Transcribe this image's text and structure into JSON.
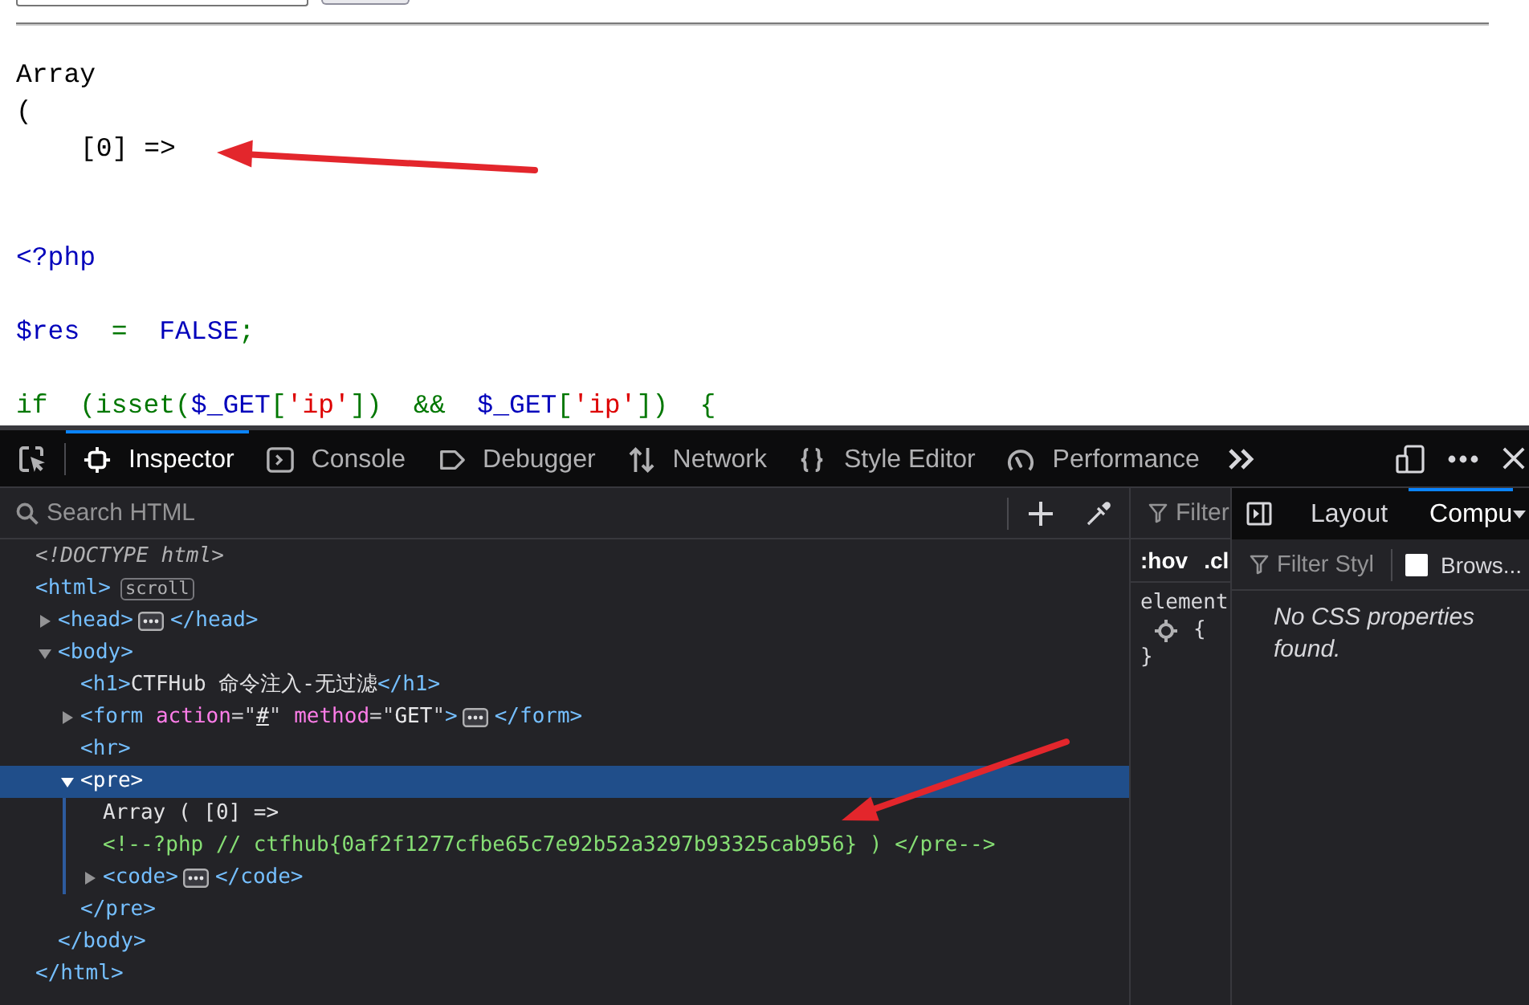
{
  "page": {
    "output": {
      "header": "Array",
      "open_paren": "(",
      "entries": [
        "[0] =>"
      ]
    },
    "code_blocks": [
      {
        "lines": [
          {
            "tokens": [
              {
                "kind": "default",
                "text": "<?php"
              }
            ]
          }
        ]
      },
      {
        "lines": [
          {
            "tokens": [
              {
                "kind": "default",
                "text": "$res"
              },
              {
                "kind": "keyword",
                "text": "  =  "
              },
              {
                "kind": "default",
                "text": "FALSE"
              },
              {
                "kind": "keyword",
                "text": ";"
              }
            ]
          }
        ]
      },
      {
        "lines": [
          {
            "tokens": [
              {
                "kind": "keyword",
                "text": "if  (isset("
              },
              {
                "kind": "default",
                "text": "$_GET"
              },
              {
                "kind": "keyword",
                "text": "["
              },
              {
                "kind": "string",
                "text": "'ip'"
              },
              {
                "kind": "keyword",
                "text": "])  &&  "
              },
              {
                "kind": "default",
                "text": "$_GET"
              },
              {
                "kind": "keyword",
                "text": "["
              },
              {
                "kind": "string",
                "text": "'ip'"
              },
              {
                "kind": "keyword",
                "text": "])  {"
              }
            ]
          }
        ]
      }
    ]
  },
  "devtools": {
    "toolbar": {
      "tabs": [
        {
          "kind": "inspector",
          "label": "Inspector",
          "selected": true
        },
        {
          "kind": "console",
          "label": "Console",
          "selected": false
        },
        {
          "kind": "debugger",
          "label": "Debugger",
          "selected": false
        },
        {
          "kind": "network",
          "label": "Network",
          "selected": false
        },
        {
          "kind": "styles",
          "label": "Style Editor",
          "selected": false
        },
        {
          "kind": "performance",
          "label": "Performance",
          "selected": false
        }
      ]
    },
    "search": {
      "placeholder": "Search HTML"
    },
    "tree": [
      {
        "selected": false,
        "open": [
          {
            "kind": "doctype",
            "text": "<!DOCTYPE html>"
          }
        ]
      },
      {
        "selected": false,
        "open": [
          {
            "kind": "tag",
            "text": "<html>"
          }
        ],
        "badge": "scroll",
        "close": [
          {
            "kind": "tag",
            "text": "</html>"
          }
        ],
        "children": [
          {
            "selected": false,
            "expanded": false,
            "open": [
              {
                "kind": "tag",
                "text": "<head>"
              }
            ],
            "close": [
              {
                "kind": "tag",
                "text": "</head>"
              }
            ]
          },
          {
            "selected": false,
            "expanded": true,
            "open": [
              {
                "kind": "tag",
                "text": "<body>"
              }
            ],
            "close": [
              {
                "kind": "tag",
                "text": "</body>"
              }
            ],
            "children": [
              {
                "selected": false,
                "open": [
                  {
                    "kind": "tag",
                    "text": "<h1>"
                  },
                  {
                    "kind": "text",
                    "text": "CTFHub 命令注入-无过滤"
                  },
                  {
                    "kind": "tag",
                    "text": "</h1>"
                  }
                ]
              },
              {
                "selected": false,
                "expanded": false,
                "open": [
                  {
                    "kind": "tag",
                    "text": "<form"
                  },
                  {
                    "kind": "attr",
                    "text": " action"
                  },
                  {
                    "kind": "punct",
                    "text": "=\""
                  },
                  {
                    "kind": "link",
                    "text": "#"
                  },
                  {
                    "kind": "punct",
                    "text": "\""
                  },
                  {
                    "kind": "attr",
                    "text": " method"
                  },
                  {
                    "kind": "punct",
                    "text": "=\""
                  },
                  {
                    "kind": "value",
                    "text": "GET"
                  },
                  {
                    "kind": "punct",
                    "text": "\""
                  },
                  {
                    "kind": "tag",
                    "text": ">"
                  }
                ],
                "close": [
                  {
                    "kind": "tag",
                    "text": "</form>"
                  }
                ]
              },
              {
                "selected": false,
                "open": [
                  {
                    "kind": "tag",
                    "text": "<hr>"
                  }
                ]
              },
              {
                "selected": true,
                "expanded": true,
                "open": [
                  {
                    "kind": "tag",
                    "text": "<pre>"
                  }
                ],
                "close": [
                  {
                    "kind": "tag",
                    "text": "</pre>"
                  }
                ],
                "children": [
                  {
                    "selected": false,
                    "open": [
                      {
                        "kind": "text",
                        "text": "Array ( [0] =>"
                      }
                    ]
                  },
                  {
                    "selected": false,
                    "open": [
                      {
                        "kind": "comment",
                        "text": "<!--?php // ctfhub{0af2f1277cfbe65c7e92b52a3297b93325cab956} ) </pre-->"
                      }
                    ]
                  },
                  {
                    "selected": false,
                    "expanded": false,
                    "open": [
                      {
                        "kind": "tag",
                        "text": "<code>"
                      }
                    ],
                    "close": [
                      {
                        "kind": "tag",
                        "text": "</code>"
                      }
                    ]
                  }
                ]
              }
            ]
          }
        ]
      }
    ],
    "rules": {
      "filter_placeholder": "Filter",
      "toggles": [
        ":hov",
        ".cl"
      ],
      "selector": "element",
      "open_brace": "{",
      "close_brace": "}"
    },
    "computed": {
      "tabs": [
        {
          "label": "Layout",
          "selected": false
        },
        {
          "label": "Compu",
          "selected": true
        }
      ],
      "filter_placeholder": "Filter Styl",
      "browser_styles": {
        "label": "Brows...",
        "checked": false
      },
      "empty_message": "No CSS properties found."
    }
  }
}
